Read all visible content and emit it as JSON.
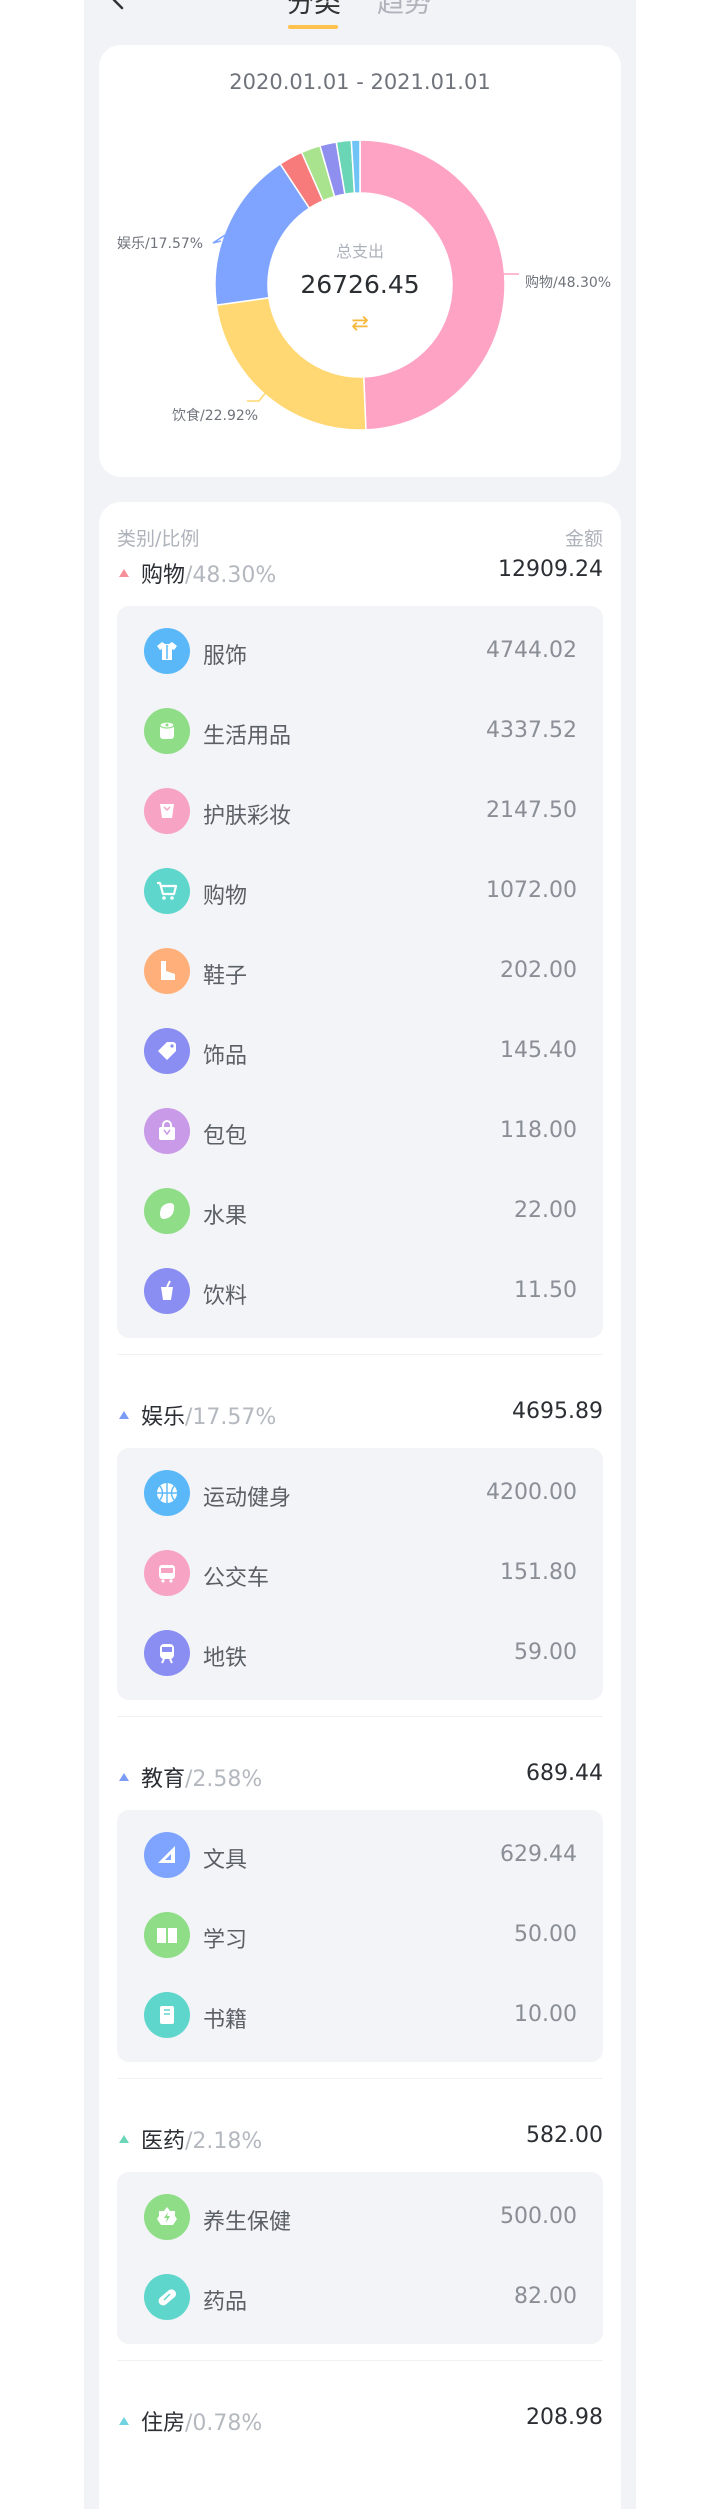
{
  "header": {
    "tabs": [
      "分类",
      "趋势"
    ],
    "active_tab": 0
  },
  "range": "2020.01.01 - 2021.01.01",
  "summary": {
    "title": "总支出",
    "total": "26726.45"
  },
  "chart_data": {
    "type": "pie",
    "total": 26726.45,
    "slices": [
      {
        "name": "购物",
        "value": 12909.24,
        "pct": 48.3,
        "color": "#ffa3c4",
        "label": "购物/48.30%"
      },
      {
        "name": "饮食",
        "value": 6129.2,
        "pct": 22.92,
        "color": "#ffd873",
        "label": "饮食/22.92%"
      },
      {
        "name": "娱乐",
        "value": 4695.89,
        "pct": 17.57,
        "color": "#7ea4ff",
        "label": "娱乐/17.57%"
      },
      {
        "name": "red",
        "value": 700,
        "pct": 2.62,
        "color": "#f77b7b",
        "label": ""
      },
      {
        "name": "green",
        "value": 560,
        "pct": 2.1,
        "color": "#a9e38d",
        "label": ""
      },
      {
        "name": "purple",
        "value": 480,
        "pct": 1.8,
        "color": "#8f8ff0",
        "label": ""
      },
      {
        "name": "teal",
        "value": 435,
        "pct": 1.63,
        "color": "#6bd6b5",
        "label": ""
      },
      {
        "name": "blue2",
        "value": 250,
        "pct": 0.94,
        "color": "#6fc3f5",
        "label": ""
      }
    ]
  },
  "list": {
    "col_left": "类别/比例",
    "col_right": "金额",
    "groups": [
      {
        "name": "购物",
        "pct": "/48.30%",
        "amount": "12909.24",
        "color": "#f78f9a",
        "items": [
          {
            "name": "服饰",
            "amount": "4744.02",
            "color": "#5ab8f8",
            "icon": "shirt-icon"
          },
          {
            "name": "生活用品",
            "amount": "4337.52",
            "color": "#8fdd86",
            "icon": "tissue-roll-icon"
          },
          {
            "name": "护肤彩妆",
            "amount": "2147.50",
            "color": "#f7a3c4",
            "icon": "cosmetics-icon"
          },
          {
            "name": "购物",
            "amount": "1072.00",
            "color": "#5fd6cc",
            "icon": "cart-icon"
          },
          {
            "name": "鞋子",
            "amount": "202.00",
            "color": "#ffb07a",
            "icon": "shoe-icon"
          },
          {
            "name": "饰品",
            "amount": "145.40",
            "color": "#8a8df2",
            "icon": "ring-icon"
          },
          {
            "name": "包包",
            "amount": "118.00",
            "color": "#c99ae8",
            "icon": "bag-icon"
          },
          {
            "name": "水果",
            "amount": "22.00",
            "color": "#8fdd86",
            "icon": "fruit-icon"
          },
          {
            "name": "饮料",
            "amount": "11.50",
            "color": "#8a8df2",
            "icon": "cup-icon"
          }
        ]
      },
      {
        "name": "娱乐",
        "pct": "/17.57%",
        "amount": "4695.89",
        "color": "#7b9bf5",
        "items": [
          {
            "name": "运动健身",
            "amount": "4200.00",
            "color": "#5ab8f8",
            "icon": "basketball-icon"
          },
          {
            "name": "公交车",
            "amount": "151.80",
            "color": "#f7a3c4",
            "icon": "bus-icon"
          },
          {
            "name": "地铁",
            "amount": "59.00",
            "color": "#8a8df2",
            "icon": "subway-icon"
          }
        ]
      },
      {
        "name": "教育",
        "pct": "/2.58%",
        "amount": "689.44",
        "color": "#7b9bf5",
        "items": [
          {
            "name": "文具",
            "amount": "629.44",
            "color": "#7ea4ff",
            "icon": "ruler-icon"
          },
          {
            "name": "学习",
            "amount": "50.00",
            "color": "#8fdd86",
            "icon": "open-book-icon"
          },
          {
            "name": "书籍",
            "amount": "10.00",
            "color": "#5fd6cc",
            "icon": "book-icon"
          }
        ]
      },
      {
        "name": "医药",
        "pct": "/2.18%",
        "amount": "582.00",
        "color": "#6bd6b5",
        "items": [
          {
            "name": "养生保健",
            "amount": "500.00",
            "color": "#8fdd86",
            "icon": "health-icon"
          },
          {
            "name": "药品",
            "amount": "82.00",
            "color": "#5fd6cc",
            "icon": "pill-icon"
          }
        ]
      },
      {
        "name": "住房",
        "pct": "/0.78%",
        "amount": "208.98",
        "color": "#6fd4e0",
        "items": []
      }
    ]
  }
}
